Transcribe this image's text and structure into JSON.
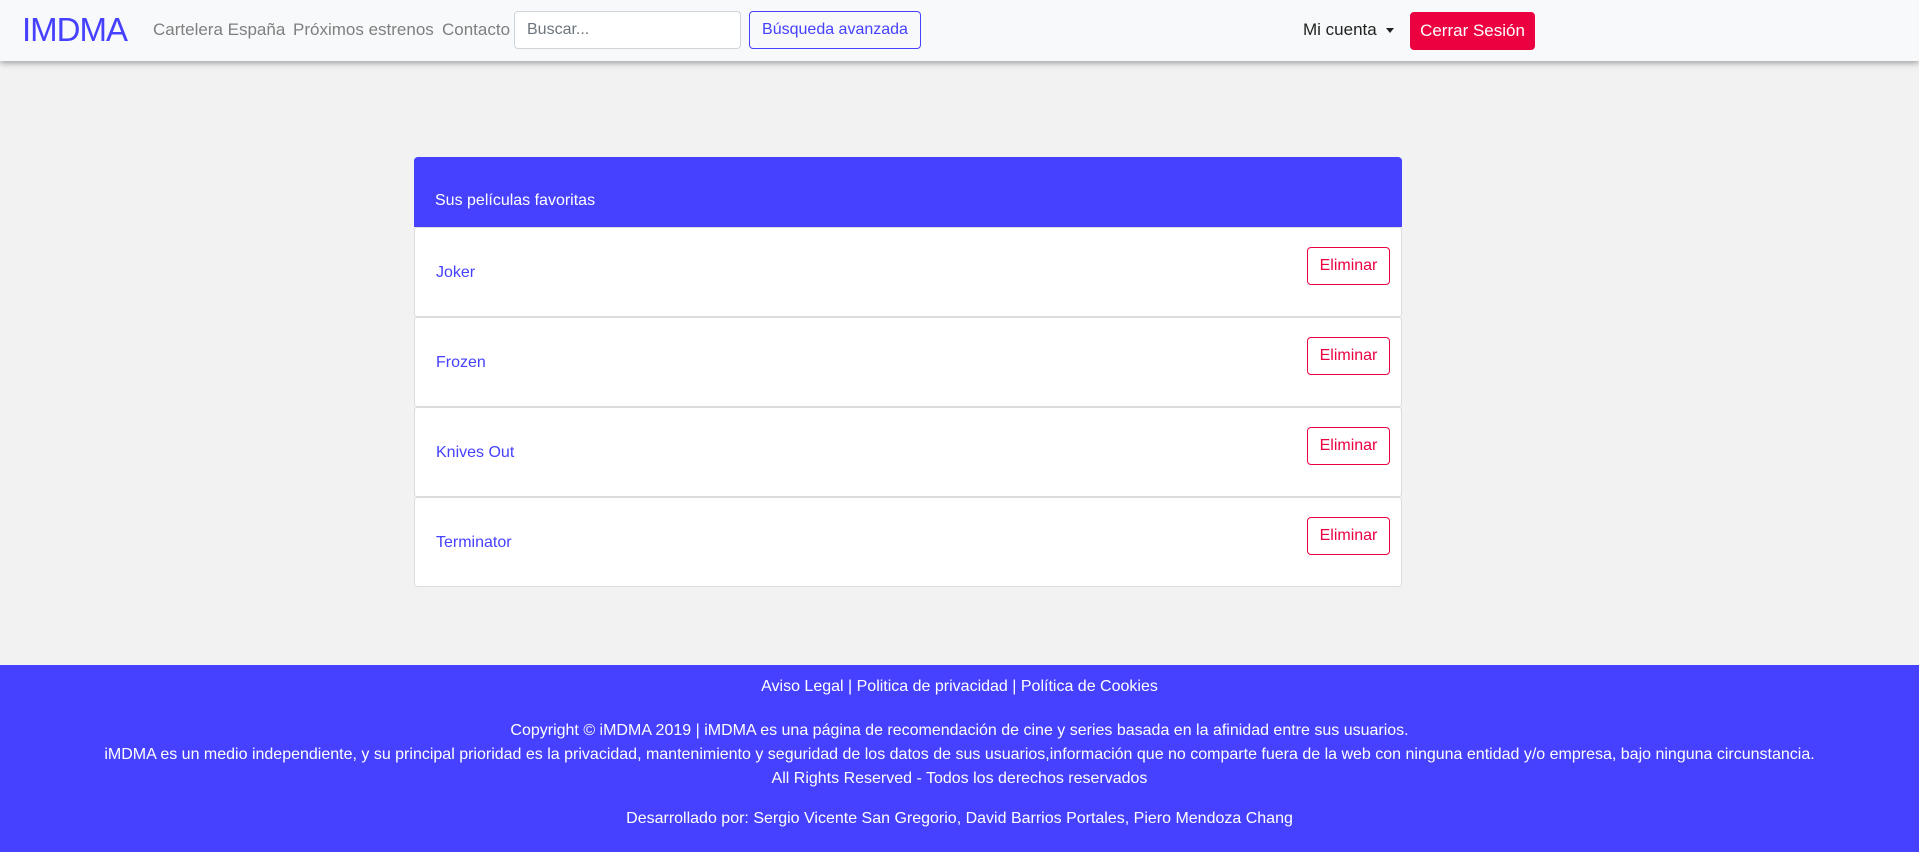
{
  "navbar": {
    "logo": "IMDMA",
    "links": [
      "Cartelera España",
      "Próximos estrenos",
      "Contacto"
    ],
    "search_placeholder": "Buscar...",
    "advanced_search": "Búsqueda avanzada",
    "account": "Mi cuenta",
    "logout": "Cerrar Sesión"
  },
  "favorites": {
    "header": "Sus películas favoritas",
    "items": [
      {
        "title": "Joker",
        "action": "Eliminar"
      },
      {
        "title": "Frozen",
        "action": "Eliminar"
      },
      {
        "title": "Knives Out",
        "action": "Eliminar"
      },
      {
        "title": "Terminator",
        "action": "Eliminar"
      }
    ]
  },
  "footer": {
    "links": [
      "Aviso Legal",
      "Politica de privacidad",
      "Política de Cookies"
    ],
    "separator": " | ",
    "copyright": "Copyright © iMDMA 2019 | iMDMA es una página de recomendación de cine y series basada en la afinidad entre sus usuarios.",
    "privacy": "iMDMA es un medio independiente, y su principal prioridad es la privacidad, mantenimiento y seguridad de los datos de sus usuarios,información que no comparte fuera de la web con ninguna entidad y/o empresa, bajo ninguna circunstancia.",
    "rights": "All Rights Reserved - Todos los derechos reservados",
    "developers": "Desarrollado por: Sergio Vicente San Gregorio, David Barrios Portales, Piero Mendoza Chang"
  },
  "colors": {
    "brand": "#4640ff",
    "danger": "#eb0040",
    "background": "#f2f2f2"
  }
}
